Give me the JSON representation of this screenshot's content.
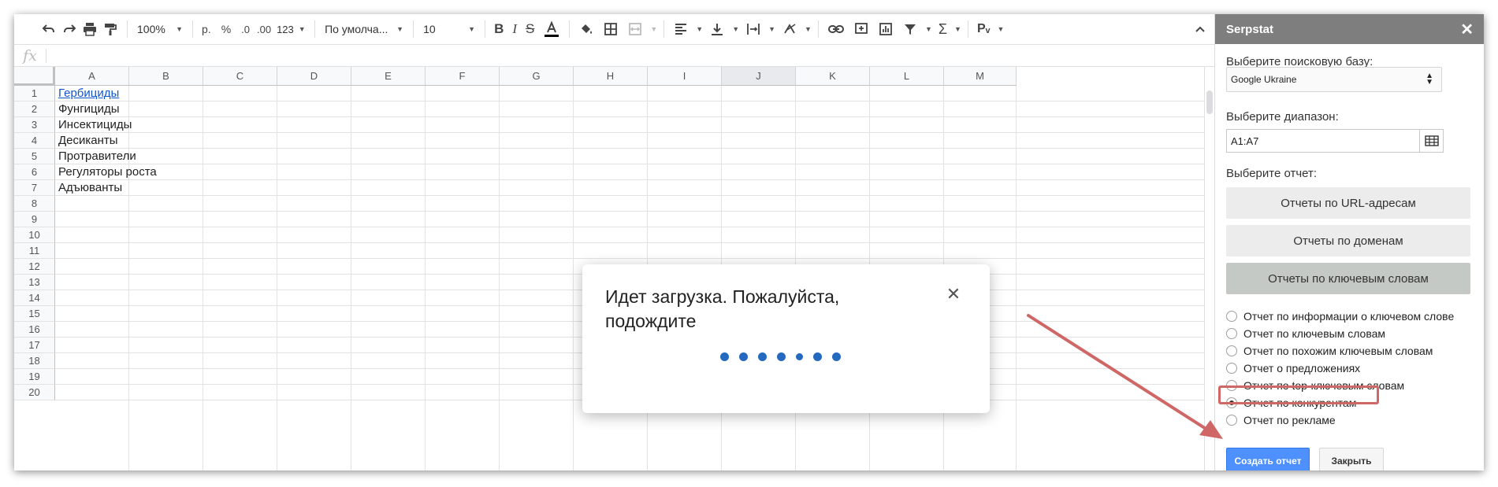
{
  "toolbar": {
    "zoom": "100%",
    "currency": "р.",
    "percent": "%",
    "dec_decrease": ".0",
    "dec_increase": ".00",
    "more_formats": "123",
    "font": "По умолча...",
    "font_size": "10"
  },
  "formula_bar": {
    "fx": "fx",
    "value": ""
  },
  "grid": {
    "columns": [
      "A",
      "B",
      "C",
      "D",
      "E",
      "F",
      "G",
      "H",
      "I",
      "J",
      "K",
      "L",
      "M"
    ],
    "selected_column": "J",
    "rows": [
      "1",
      "2",
      "3",
      "4",
      "5",
      "6",
      "7",
      "8",
      "9",
      "10",
      "11",
      "12",
      "13",
      "14",
      "15",
      "16",
      "17",
      "18",
      "19",
      "20"
    ],
    "cells": [
      "Гербициды",
      "Фунгициды",
      "Инсектициды",
      "Десиканты",
      "Протравители",
      "Регуляторы роста",
      "Адъюванты"
    ]
  },
  "modal": {
    "title": "Идет загрузка. Пожалуйста, подождите",
    "close_icon": "close-icon"
  },
  "sidebar": {
    "title": "Serpstat",
    "base_label": "Выберите поисковую базу:",
    "base_value": "Google Ukraine",
    "range_label": "Выберите диапазон:",
    "range_value": "A1:A7",
    "report_label": "Выберите отчет:",
    "report_buttons": [
      "Отчеты по URL-адресам",
      "Отчеты по доменам",
      "Отчеты по ключевым словам"
    ],
    "active_report_button": 2,
    "options": [
      "Отчет по информации о ключевом слове",
      "Отчет по ключевым словам",
      "Отчет по похожим ключевым словам",
      "Отчет о предложениях",
      "Отчет по top-ключевым словам",
      "Отчет по конкурентам",
      "Отчет по рекламе"
    ],
    "selected_option": 5,
    "create_button": "Создать отчет",
    "close_button": "Закрыть"
  },
  "colors": {
    "sidebar_header": "#7e7e7e",
    "primary_button": "#4d90fe",
    "annotation": "#cf6767",
    "loader": "#2468c0",
    "link": "#1155cc"
  }
}
